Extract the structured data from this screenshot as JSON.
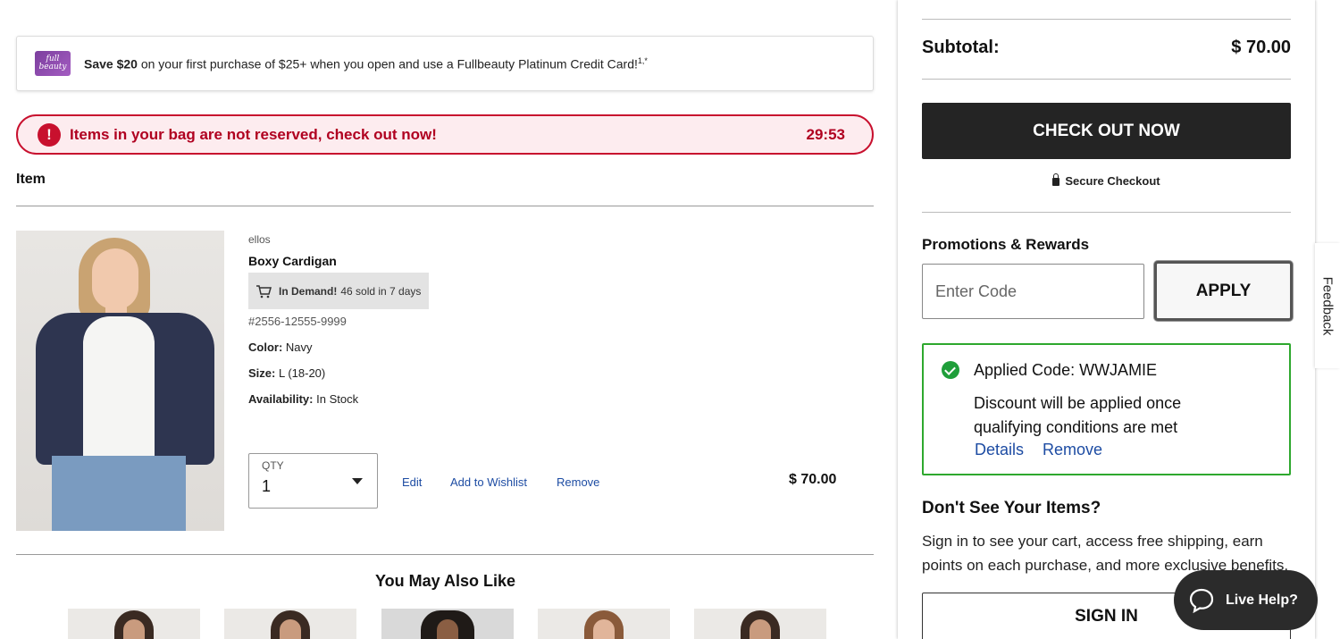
{
  "promo_banner": {
    "logo_text": "full beauty",
    "bold": "Save $20",
    "text": " on your first purchase of $25+ when you open and use a Fullbeauty Platinum Credit Card!",
    "sup": "1,*"
  },
  "alert": {
    "icon": "!",
    "message": "Items in your bag are not reserved, check out now!",
    "timer": "29:53"
  },
  "cart": {
    "item_header": "Item",
    "item": {
      "brand": "ellos",
      "name": "Boxy Cardigan",
      "demand_label": "In Demand!",
      "demand_text": "46 sold in 7 days",
      "sku": "#2556-12555-9999",
      "color_label": "Color:",
      "color_value": "Navy",
      "size_label": "Size:",
      "size_value": "L (18-20)",
      "availability_label": "Availability:",
      "availability_value": "In Stock",
      "qty_label": "QTY",
      "qty_value": "1",
      "edit": "Edit",
      "wishlist": "Add to Wishlist",
      "remove": "Remove",
      "price": "$ 70.00"
    }
  },
  "recommendations": {
    "title": "You May Also Like",
    "count": 5
  },
  "summary": {
    "subtotal_label": "Subtotal:",
    "subtotal_value": "$ 70.00",
    "checkout_label": "CHECK OUT NOW",
    "secure_label": "Secure Checkout"
  },
  "promotions": {
    "title": "Promotions & Rewards",
    "input_placeholder": "Enter Code",
    "apply_label": "APPLY",
    "applied_code": "Applied Code: WWJAMIE",
    "discount_note": "Discount will be applied once qualifying conditions are met",
    "details_link": "Details",
    "remove_link": "Remove"
  },
  "signin_section": {
    "title": "Don't See Your Items?",
    "text": "Sign in to see your cart, access free shipping, earn points on each purchase, and more exclusive benefits.",
    "button": "SIGN IN"
  },
  "feedback": "Feedback",
  "live_help": "Live Help?",
  "colors": {
    "alert_red": "#c8102e",
    "link_blue": "#1d4ca3",
    "success_green": "#2ea82e",
    "dark_button": "#242424"
  }
}
